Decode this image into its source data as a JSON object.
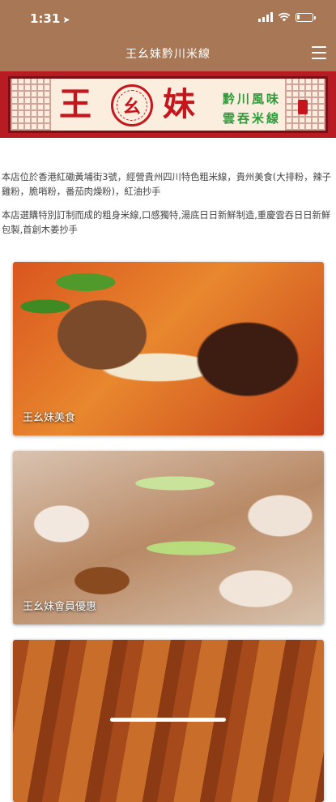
{
  "status_bar": {
    "time": "1:31",
    "location_icon": "location-arrow-icon",
    "signal_icon": "cellular-signal-icon",
    "wifi_icon": "wifi-icon",
    "battery_icon": "battery-icon",
    "battery_level": 0.2
  },
  "nav": {
    "title": "王幺妹黔川米線",
    "menu_icon": "hamburger-menu-icon"
  },
  "banner": {
    "brand_chars": [
      "王",
      "幺",
      "妹"
    ],
    "slogan_line1": "黔川風味",
    "slogan_line2": "雲吞米線"
  },
  "intro": {
    "paragraph1": "本店位於香港紅磡黃埔街3號，經營貴州四川特色粗米線，貴州美食(大排粉，辣子雞粉，脆哨粉，番茄肉燥粉)，紅油抄手",
    "paragraph2": "本店選購特別訂制而成的粗身米線,口感獨特,湯底日日新鮮制造,重慶雲吞日日新鮮包製,首創木姜抄手"
  },
  "cards": [
    {
      "label": "王幺妹美食"
    },
    {
      "label": "王幺妹會員優惠"
    },
    {
      "label": ""
    }
  ],
  "colors": {
    "header_bg": "#a87856",
    "banner_red": "#b91b22",
    "brand_red": "#c4161c",
    "slogan_green": "#2f9a3a"
  }
}
